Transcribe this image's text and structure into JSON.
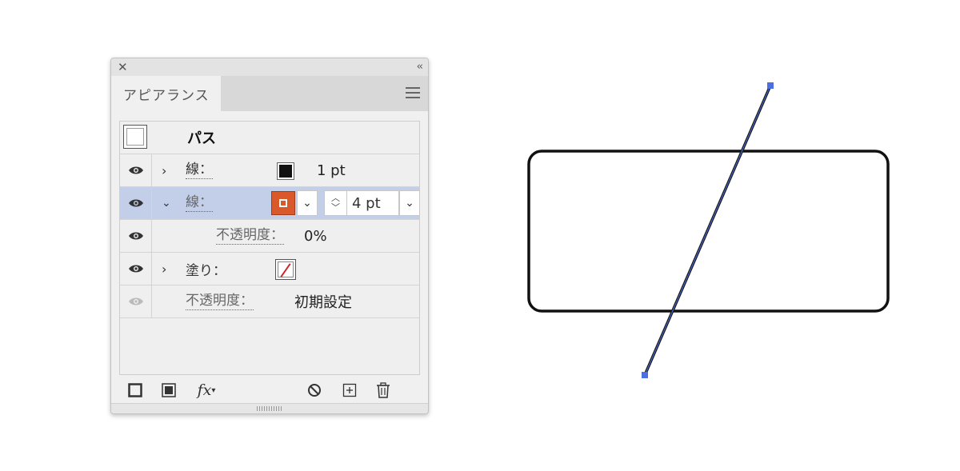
{
  "panel": {
    "tab_label": "アピアランス",
    "object_label": "パス",
    "rows": [
      {
        "label": "線：",
        "value": "1 pt"
      },
      {
        "label": "線：",
        "value": "4 pt"
      },
      {
        "label": "不透明度：",
        "value": "0%"
      },
      {
        "label": "塗り：",
        "value": ""
      },
      {
        "label": "不透明度：",
        "value": "初期設定"
      }
    ],
    "toolbar": {
      "fx_label": "fx"
    }
  },
  "colors": {
    "stroke_swatch": "#111111",
    "active_stroke_swatch": "#d9592a",
    "selection_highlight": "#c3cfe9",
    "path_selection": "#4b6fe0"
  }
}
